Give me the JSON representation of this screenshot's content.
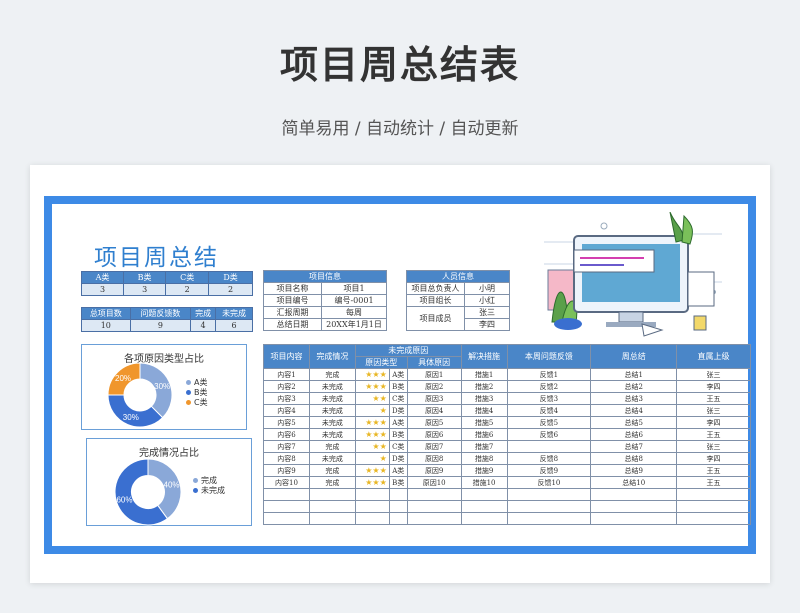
{
  "header": {
    "title": "项目周总结表",
    "subtitle": "简单易用 / 自动统计 / 自动更新"
  },
  "sheet": {
    "title": "项目周总结"
  },
  "type_table": {
    "headers": [
      "A类",
      "B类",
      "C类",
      "D类"
    ],
    "values": [
      "3",
      "3",
      "2",
      "2"
    ]
  },
  "status_table": {
    "headers": [
      "总项目数",
      "问题反馈数",
      "完成",
      "未完成"
    ],
    "values": [
      "10",
      "9",
      "4",
      "6"
    ]
  },
  "project_info": {
    "header": "项目信息",
    "rows": [
      [
        "项目名称",
        "项目1"
      ],
      [
        "项目编号",
        "编号-0001"
      ],
      [
        "汇报周期",
        "每周"
      ],
      [
        "总结日期",
        "20XX年1月1日"
      ]
    ]
  },
  "people_info": {
    "header": "人员信息",
    "rows": [
      [
        "项目总负责人",
        "小明"
      ],
      [
        "项目组长",
        "小红"
      ]
    ],
    "member_label": "项目成员",
    "members": [
      "张三",
      "李四"
    ]
  },
  "chart1": {
    "title": "各项原因类型占比"
  },
  "chart2": {
    "title": "完成情况占比"
  },
  "chart_data": [
    {
      "type": "pie",
      "title": "各项原因类型占比",
      "categories": [
        "A类",
        "B类",
        "C类"
      ],
      "values": [
        30,
        30,
        20
      ],
      "labels": [
        "30%",
        "30%",
        "20%"
      ],
      "colors": [
        "#8aa8d8",
        "#3a6fd0",
        "#f0962c"
      ]
    },
    {
      "type": "pie",
      "title": "完成情况占比",
      "categories": [
        "完成",
        "未完成"
      ],
      "values": [
        40,
        60
      ],
      "labels": [
        "40%",
        "60%"
      ],
      "colors": [
        "#8aa8d8",
        "#3a6fd0"
      ]
    }
  ],
  "main_table": {
    "headers": {
      "content": "项目内容",
      "status": "完成情况",
      "reason": "未完成原因",
      "reason_type": "原因类型",
      "reason_detail": "具体原因",
      "measure": "解决措施",
      "feedback": "本周问题反馈",
      "summary": "周总结",
      "leader": "直属上级"
    },
    "rows": [
      [
        "内容1",
        "完成",
        "★★★",
        "A类",
        "原因1",
        "措施1",
        "反馈1",
        "总结1",
        "张三"
      ],
      [
        "内容2",
        "未完成",
        "★★★",
        "B类",
        "原因2",
        "措施2",
        "反馈2",
        "总结2",
        "李四"
      ],
      [
        "内容3",
        "未完成",
        "★★",
        "C类",
        "原因3",
        "措施3",
        "反馈3",
        "总结3",
        "王五"
      ],
      [
        "内容4",
        "未完成",
        "★",
        "D类",
        "原因4",
        "措施4",
        "反馈4",
        "总结4",
        "张三"
      ],
      [
        "内容5",
        "未完成",
        "★★★",
        "A类",
        "原因5",
        "措施5",
        "反馈5",
        "总结5",
        "李四"
      ],
      [
        "内容6",
        "未完成",
        "★★★",
        "B类",
        "原因6",
        "措施6",
        "反馈6",
        "总结6",
        "王五"
      ],
      [
        "内容7",
        "完成",
        "★★",
        "C类",
        "原因7",
        "措施7",
        "",
        "总结7",
        "张三"
      ],
      [
        "内容8",
        "未完成",
        "★",
        "D类",
        "原因8",
        "措施8",
        "反馈8",
        "总结8",
        "李四"
      ],
      [
        "内容9",
        "完成",
        "★★★",
        "A类",
        "原因9",
        "措施9",
        "反馈9",
        "总结9",
        "王五"
      ],
      [
        "内容10",
        "完成",
        "★★★",
        "B类",
        "原因10",
        "措施10",
        "反馈10",
        "总结10",
        "王五"
      ],
      [
        "",
        "",
        "",
        "",
        "",
        "",
        "",
        "",
        ""
      ],
      [
        "",
        "",
        "",
        "",
        "",
        "",
        "",
        "",
        ""
      ],
      [
        "",
        "",
        "",
        "",
        "",
        "",
        "",
        "",
        ""
      ]
    ]
  },
  "colors": {
    "accent": "#3d8ae6",
    "header_fill": "#4a86c8",
    "star": "#e8b623"
  },
  "icons": {
    "illustration": "computer-monitor-illustration"
  }
}
